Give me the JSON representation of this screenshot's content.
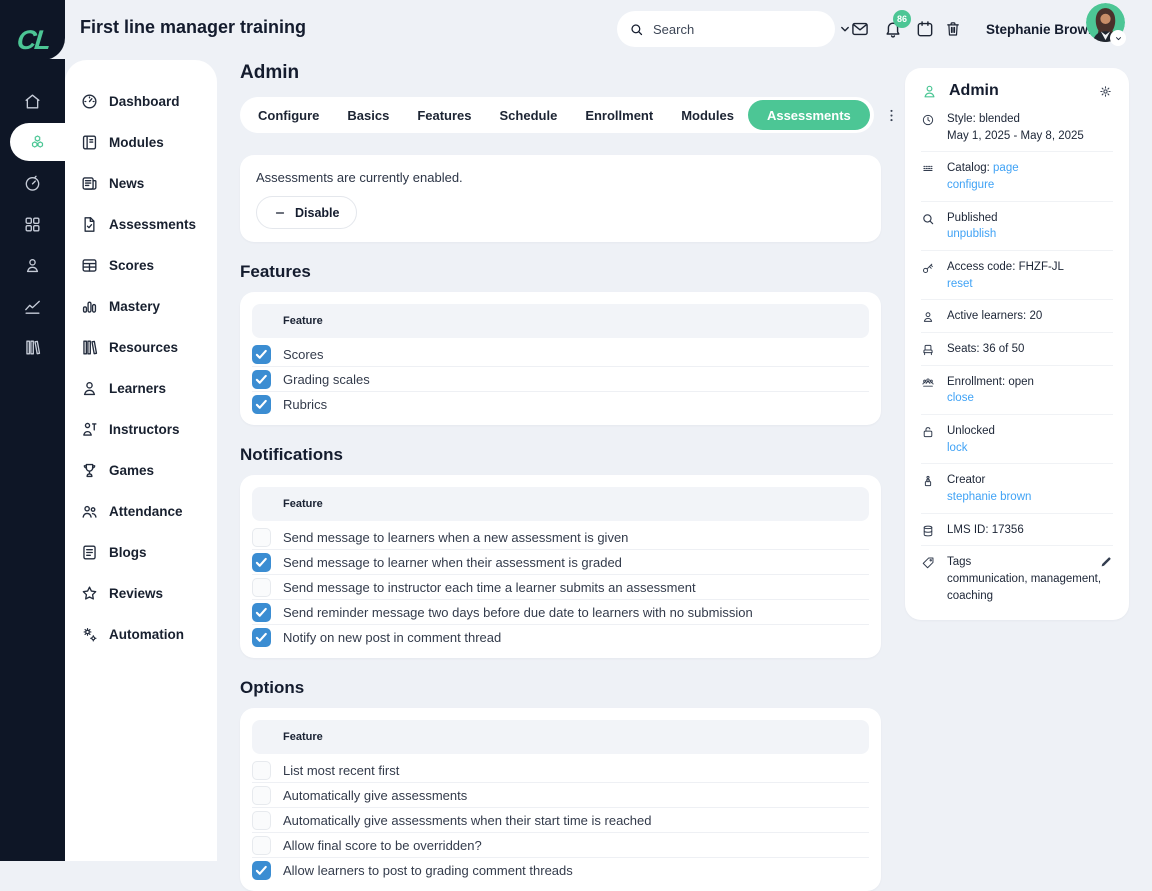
{
  "brand": {
    "logo": "CL"
  },
  "colors": {
    "accent_green": "#4cc695",
    "checkbox_blue": "#3b8dd2",
    "link_blue": "#3fa2f5",
    "navy": "#0e1626"
  },
  "topbar": {
    "title": "First line manager training",
    "search_placeholder": "Search",
    "notification_badge": "86",
    "user_name": "Stephanie Brown"
  },
  "rail": {
    "items": [
      {
        "icon": "home",
        "active": false
      },
      {
        "icon": "modules-hex",
        "active": true
      },
      {
        "icon": "gauge",
        "active": false
      },
      {
        "icon": "apps-grid",
        "active": false
      },
      {
        "icon": "person",
        "active": false
      },
      {
        "icon": "analytics",
        "active": false
      },
      {
        "icon": "library",
        "active": false
      }
    ]
  },
  "sidebar": {
    "items": [
      {
        "icon": "dashboard",
        "label": "Dashboard"
      },
      {
        "icon": "book",
        "label": "Modules"
      },
      {
        "icon": "news",
        "label": "News"
      },
      {
        "icon": "doc-check",
        "label": "Assessments"
      },
      {
        "icon": "table",
        "label": "Scores"
      },
      {
        "icon": "bar-chart",
        "label": "Mastery"
      },
      {
        "icon": "library",
        "label": "Resources"
      },
      {
        "icon": "person",
        "label": "Learners"
      },
      {
        "icon": "instructor",
        "label": "Instructors"
      },
      {
        "icon": "trophy",
        "label": "Games"
      },
      {
        "icon": "people",
        "label": "Attendance"
      },
      {
        "icon": "doc-lines",
        "label": "Blogs"
      },
      {
        "icon": "star",
        "label": "Reviews"
      },
      {
        "icon": "gears",
        "label": "Automation"
      }
    ]
  },
  "main": {
    "page_title": "Admin",
    "tabs": [
      {
        "label": "Configure",
        "active": false
      },
      {
        "label": "Basics",
        "active": false
      },
      {
        "label": "Features",
        "active": false
      },
      {
        "label": "Schedule",
        "active": false
      },
      {
        "label": "Enrollment",
        "active": false
      },
      {
        "label": "Modules",
        "active": false
      },
      {
        "label": "Assessments",
        "active": true
      }
    ],
    "status_card": {
      "message": "Assessments are currently enabled.",
      "action_label": "Disable"
    },
    "sections": [
      {
        "title": "Features",
        "column_header": "Feature",
        "rows": [
          {
            "label": "Scores",
            "checked": true
          },
          {
            "label": "Grading scales",
            "checked": true
          },
          {
            "label": "Rubrics",
            "checked": true
          }
        ]
      },
      {
        "title": "Notifications",
        "column_header": "Feature",
        "rows": [
          {
            "label": "Send message to learners when a new assessment is given",
            "checked": false
          },
          {
            "label": "Send message to learner when their assessment is graded",
            "checked": true
          },
          {
            "label": "Send message to instructor each time a learner submits an assessment",
            "checked": false
          },
          {
            "label": "Send reminder message two days before due date to learners with no submission",
            "checked": true
          },
          {
            "label": "Notify on new post in comment thread",
            "checked": true
          }
        ]
      },
      {
        "title": "Options",
        "column_header": "Feature",
        "rows": [
          {
            "label": "List most recent first",
            "checked": false
          },
          {
            "label": "Automatically give assessments",
            "checked": false
          },
          {
            "label": "Automatically give assessments when their start time is reached",
            "checked": false
          },
          {
            "label": "Allow final score to be overridden?",
            "checked": false
          },
          {
            "label": "Allow learners to post to grading comment threads",
            "checked": true
          }
        ]
      }
    ]
  },
  "admin_panel": {
    "title": "Admin",
    "style_row": {
      "label": "Style: blended",
      "dates": "May 1, 2025 - May 8, 2025"
    },
    "catalog_row": {
      "label": "Catalog: ",
      "link": "page",
      "action": "configure"
    },
    "published_row": {
      "label": "Published",
      "action": "unpublish"
    },
    "access_row": {
      "label": "Access code: FHZF-JL",
      "action": "reset"
    },
    "learners_row": {
      "label": "Active learners: 20"
    },
    "seats_row": {
      "label": "Seats: 36 of 50"
    },
    "enrollment_row": {
      "label": "Enrollment: open",
      "action": "close"
    },
    "lock_row": {
      "label": "Unlocked",
      "action": "lock"
    },
    "creator_row": {
      "label": "Creator",
      "link": "stephanie brown"
    },
    "lms_row": {
      "label": "LMS ID: 17356"
    },
    "tags_row": {
      "label": "Tags",
      "value": "communication, management, coaching"
    }
  }
}
